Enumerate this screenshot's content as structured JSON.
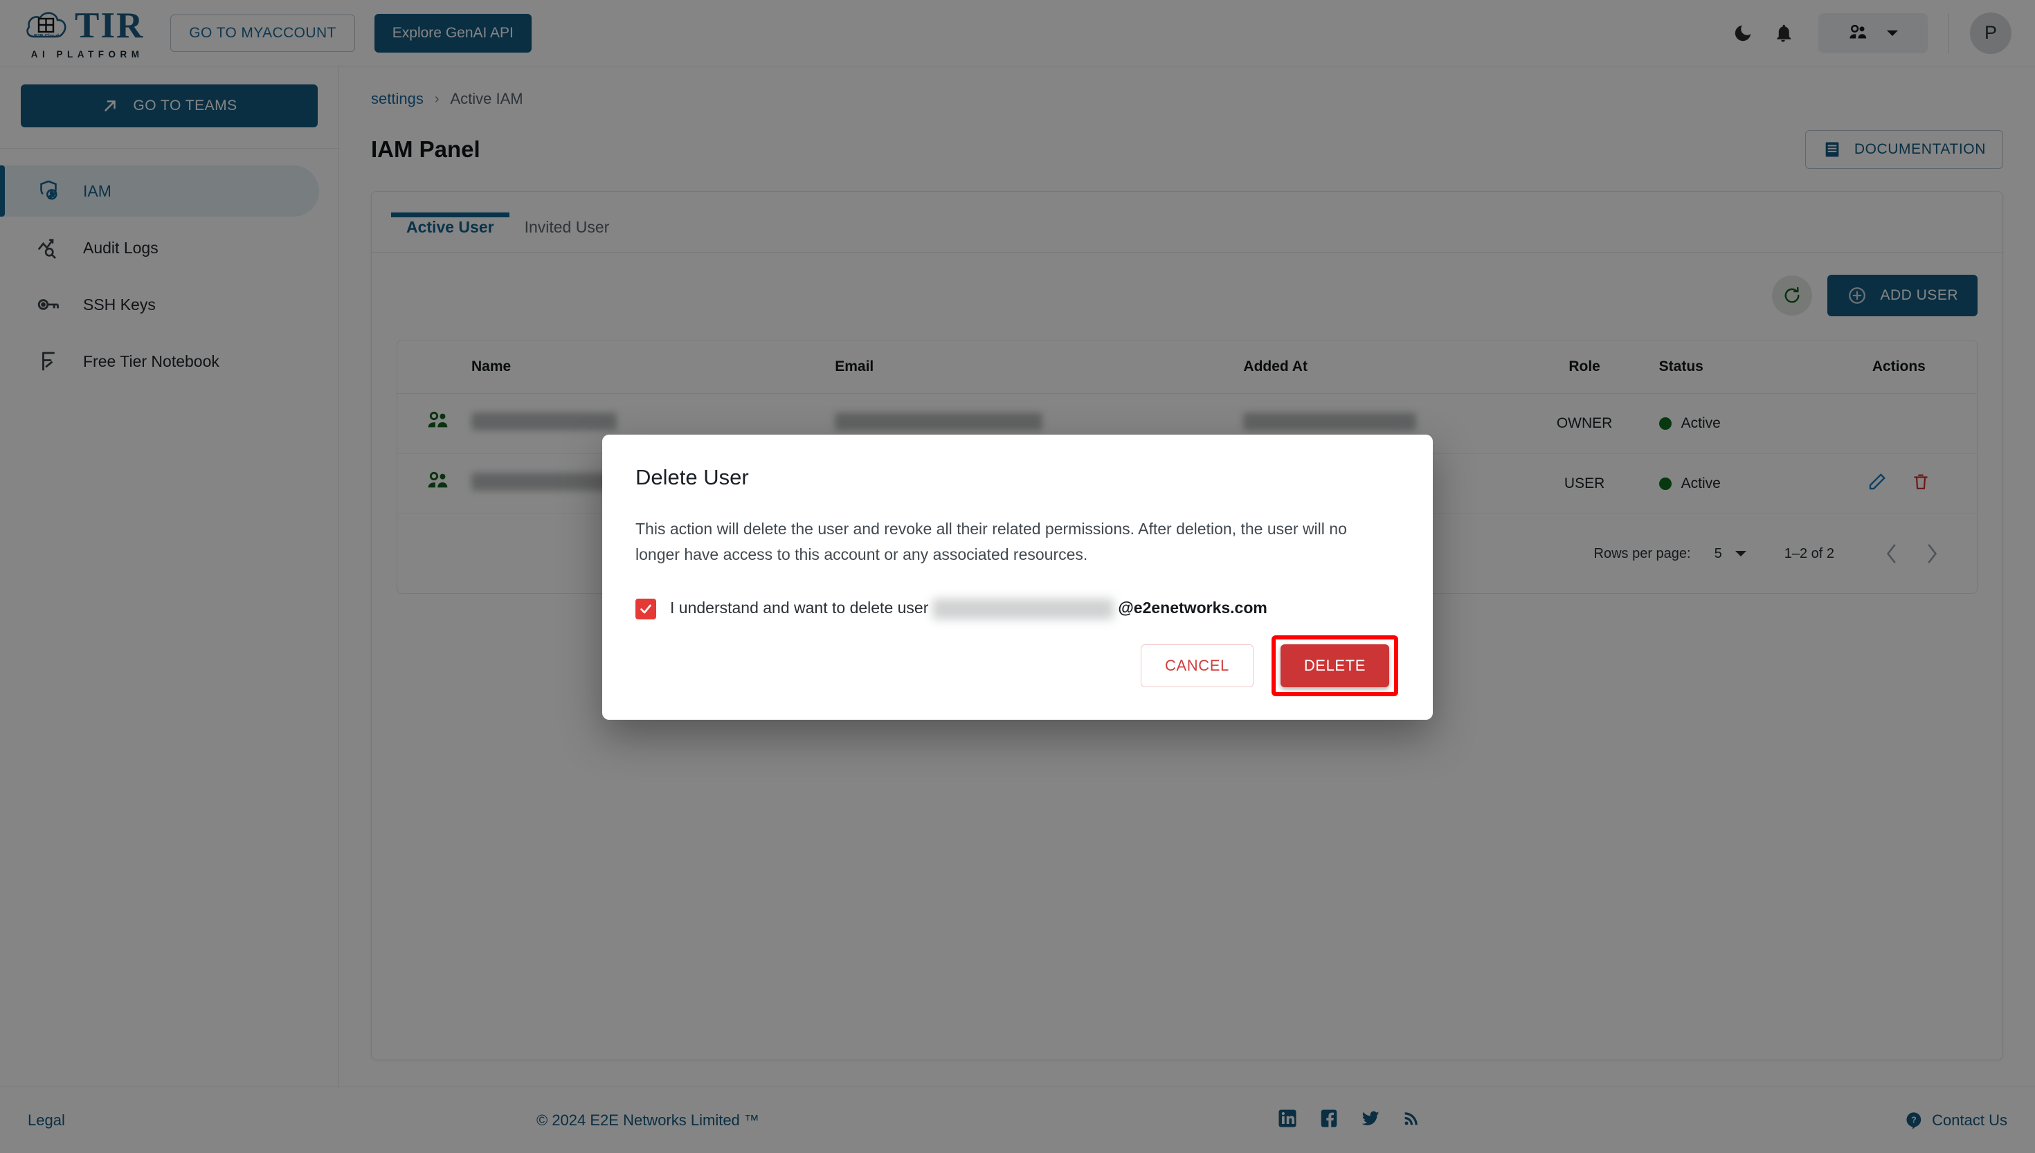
{
  "header": {
    "logo_title": "TIR",
    "logo_sub": "AI PLATFORM",
    "logo_cloud_label": "E2E Cloud",
    "myaccount_label": "GO TO MYACCOUNT",
    "genai_label": "Explore GenAI API",
    "avatar_initial": "P"
  },
  "sidebar": {
    "teams_button": "GO TO TEAMS",
    "items": [
      {
        "label": "IAM",
        "icon": "shield-user-icon",
        "active": true
      },
      {
        "label": "Audit Logs",
        "icon": "chart-search-icon",
        "active": false
      },
      {
        "label": "SSH Keys",
        "icon": "key-icon",
        "active": false
      },
      {
        "label": "Free Tier Notebook",
        "icon": "notebook-icon",
        "active": false
      }
    ]
  },
  "breadcrumb": {
    "root": "settings",
    "separator": "›",
    "current": "Active IAM"
  },
  "main": {
    "page_title": "IAM Panel",
    "documentation_label": "DOCUMENTATION",
    "tabs": [
      {
        "label": "Active User",
        "active": true
      },
      {
        "label": "Invited User",
        "active": false
      }
    ],
    "add_user_label": "ADD USER",
    "table": {
      "columns": [
        "Name",
        "Email",
        "Added At",
        "Role",
        "Status",
        "Actions"
      ],
      "rows": [
        {
          "name": "",
          "email": "",
          "added_at": "",
          "role": "OWNER",
          "status": "Active",
          "has_actions": false
        },
        {
          "name": "",
          "email": "",
          "added_at": "",
          "role": "USER",
          "status": "Active",
          "has_actions": true
        }
      ]
    },
    "pagination": {
      "rows_per_page_label": "Rows per page:",
      "rows_per_page_value": "5",
      "range": "1–2 of 2"
    }
  },
  "dialog": {
    "title": "Delete User",
    "body": "This action will delete the user and revoke all their related permissions. After deletion, the user will no longer have access to this account or any associated resources.",
    "checkbox_prefix": "I understand and want to delete user",
    "checkbox_domain": "@e2enetworks.com",
    "checkbox_checked": true,
    "cancel_label": "CANCEL",
    "delete_label": "DELETE"
  },
  "footer": {
    "legal": "Legal",
    "copyright": "© 2024 E2E Networks Limited ™",
    "contact": "Contact Us"
  },
  "colors": {
    "brand_blue": "#155a80",
    "link_blue": "#1769a0",
    "danger_red": "#cc3535",
    "highlight_red": "#ff0000",
    "active_green": "#0f6b1e"
  }
}
